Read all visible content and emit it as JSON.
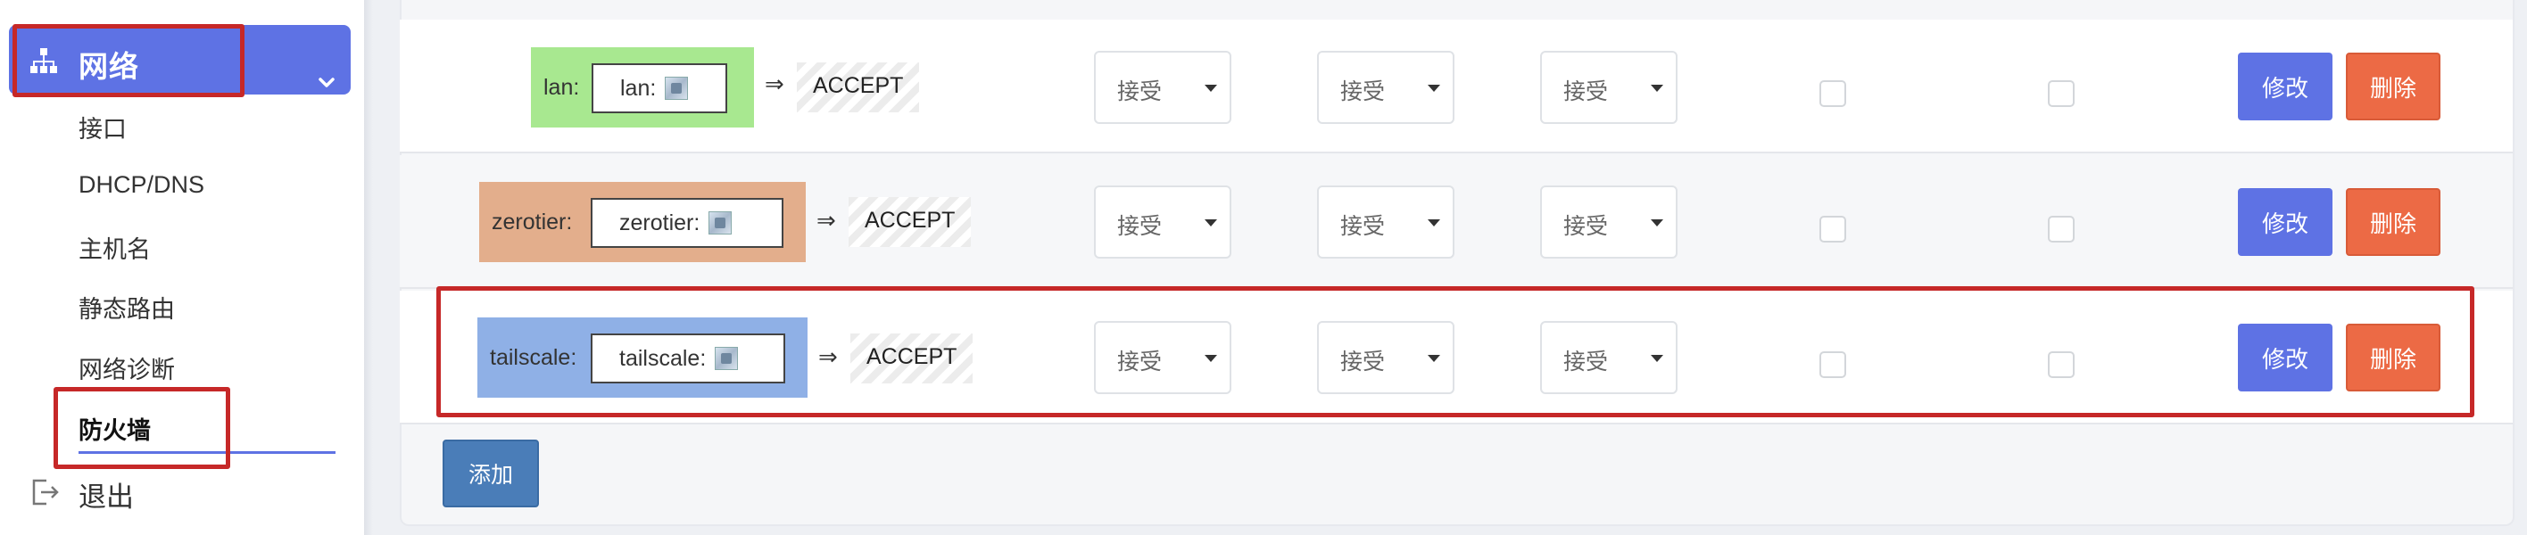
{
  "sidebar": {
    "network": {
      "label": "网络",
      "icon": "sitemap-icon"
    },
    "items": [
      {
        "label": "接口"
      },
      {
        "label": "DHCP/DNS"
      },
      {
        "label": "主机名"
      },
      {
        "label": "静态路由"
      },
      {
        "label": "网络诊断"
      },
      {
        "label": "防火墙",
        "active": true
      }
    ],
    "logout": {
      "label": "退出",
      "icon": "logout-icon"
    }
  },
  "zones": [
    {
      "name": "lan:",
      "inner": "lan:",
      "policy": "ACCEPT",
      "input": "接受",
      "output": "接受",
      "forward": "接受",
      "edit": "修改",
      "delete": "删除",
      "color": "#a8e890"
    },
    {
      "name": "zerotier:",
      "inner": "zerotier:",
      "policy": "ACCEPT",
      "input": "接受",
      "output": "接受",
      "forward": "接受",
      "edit": "修改",
      "delete": "删除",
      "color": "#e3ae8c"
    },
    {
      "name": "tailscale:",
      "inner": "tailscale:",
      "policy": "ACCEPT",
      "input": "接受",
      "output": "接受",
      "forward": "接受",
      "edit": "修改",
      "delete": "删除",
      "color": "#8fb0e6"
    }
  ],
  "arrow": "⇒",
  "add_label": "添加",
  "colors": {
    "accent": "#5e72e4",
    "danger": "#ec6a45",
    "add": "#4a7db8",
    "highlight": "#c62828"
  }
}
